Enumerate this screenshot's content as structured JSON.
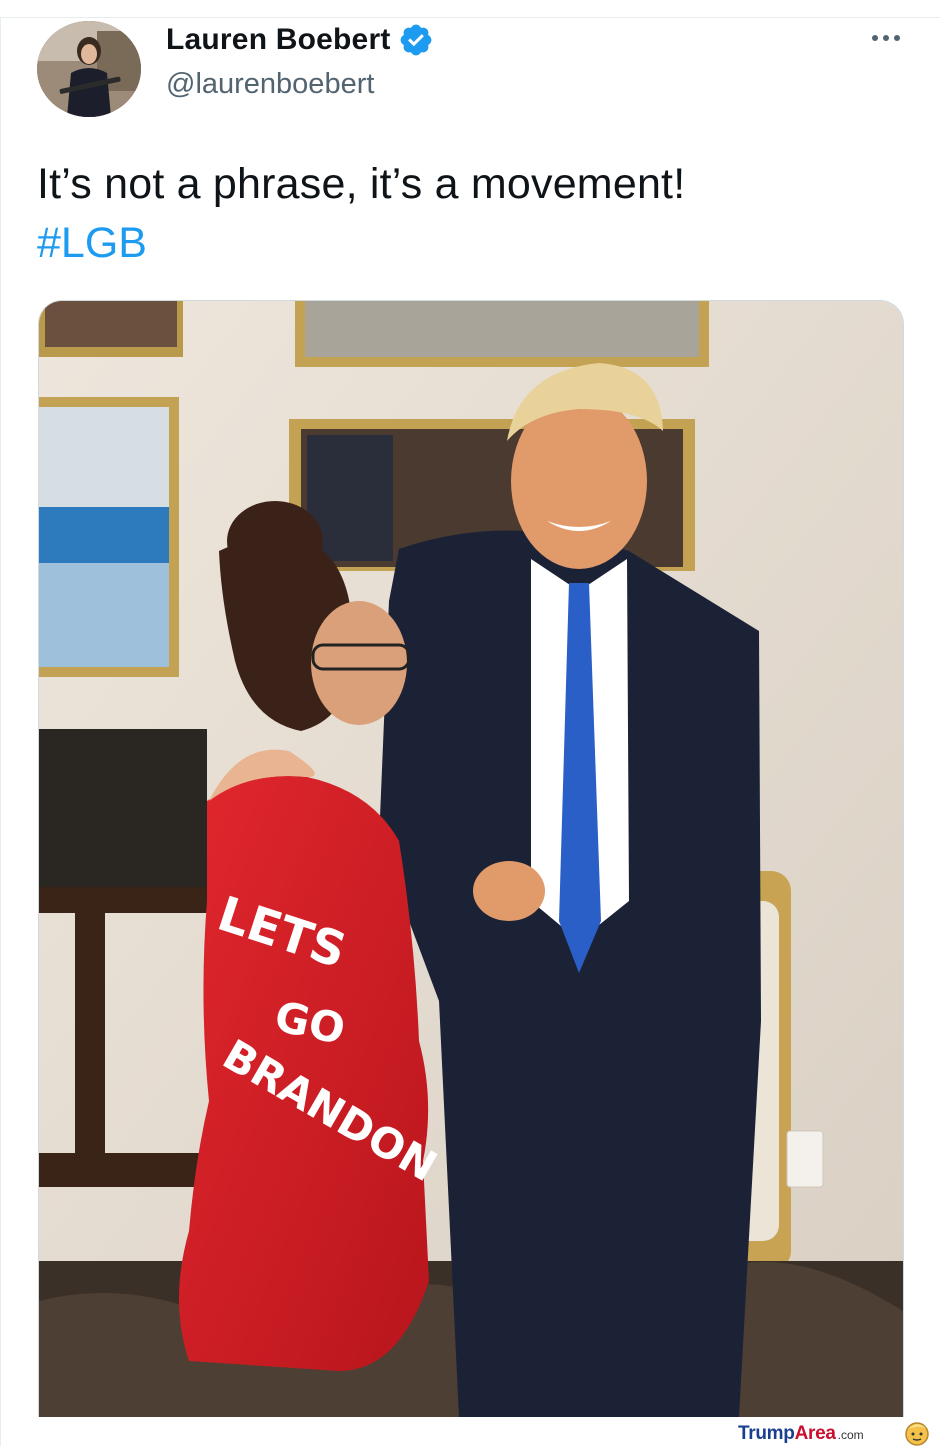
{
  "tweet": {
    "author": {
      "display_name": "Lauren Boebert",
      "handle": "@laurenboebert",
      "verified": true
    },
    "text": "It’s not a phrase, it’s a movement!",
    "hashtag": "#LGB",
    "more_icon": "ellipsis-icon",
    "media": {
      "dress_text": {
        "line1": "LETS",
        "line2": "GO",
        "line3": "BRANDON"
      }
    }
  },
  "watermark": {
    "brand_part1": "Trump",
    "brand_part2": "Area",
    "suffix": ".com"
  },
  "colors": {
    "link": "#1d9bf0",
    "verified_badge": "#1d9bf0",
    "text_primary": "#0f1419",
    "text_secondary": "#536471",
    "dress": "#d71f26",
    "tie": "#2b5fc8"
  }
}
